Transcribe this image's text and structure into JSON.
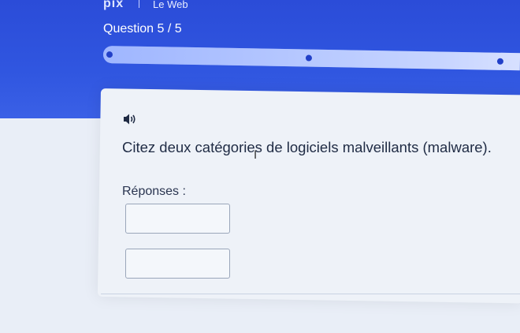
{
  "header": {
    "brand": "pix",
    "context": "Le Web",
    "question_counter": "Question 5 / 5",
    "progress": {
      "current": 5,
      "total": 5
    }
  },
  "question": {
    "audio_icon": "speaker-icon",
    "text": "Citez deux catégories de logiciels malveillants (malware)."
  },
  "answers": {
    "label": "Réponses :",
    "fields": [
      {
        "value": "",
        "placeholder": ""
      },
      {
        "value": "",
        "placeholder": ""
      }
    ]
  },
  "colors": {
    "header_blue": "#3056e0",
    "progress_fill": "#c6d4ff",
    "step_dot": "#2240c8",
    "card_background": "#eef2f8"
  }
}
